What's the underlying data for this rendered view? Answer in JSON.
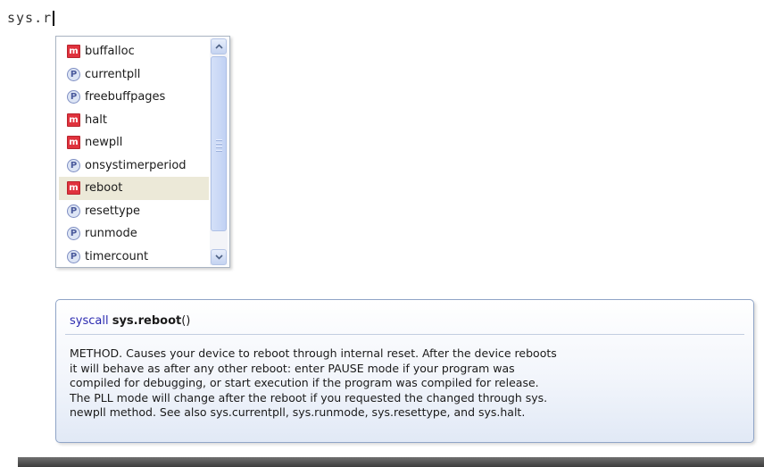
{
  "editor": {
    "text": "sys.r"
  },
  "completion": {
    "items": [
      {
        "label": "buffalloc",
        "kind": "m"
      },
      {
        "label": "currentpll",
        "kind": "P"
      },
      {
        "label": "freebuffpages",
        "kind": "P"
      },
      {
        "label": "halt",
        "kind": "m"
      },
      {
        "label": "newpll",
        "kind": "m"
      },
      {
        "label": "onsystimerperiod",
        "kind": "P"
      },
      {
        "label": "reboot",
        "kind": "m"
      },
      {
        "label": "resettype",
        "kind": "P"
      },
      {
        "label": "runmode",
        "kind": "P"
      },
      {
        "label": "timercount",
        "kind": "P"
      }
    ],
    "selected": "reboot"
  },
  "tooltip": {
    "keyword": "syscall",
    "name": "sys.reboot",
    "params": "()",
    "description": "METHOD. Causes your device to reboot through internal reset. After the device reboots\nit will behave as after any other reboot: enter PAUSE mode if your program was\ncompiled for debugging, or start execution if the program was compiled for release.\nThe PLL mode will change after the reboot if you requested the changed through sys.\nnewpll method. See also sys.currentpll, sys.runmode, sys.resettype, and sys.halt."
  },
  "colors": {
    "method_icon": "#e0323d",
    "property_icon": "#7f8fc3",
    "selection": "#ece9d8",
    "keyword": "#2a2ab0"
  },
  "icons": {
    "method": "method-icon",
    "property": "property-icon",
    "scroll_up": "scroll-up-icon",
    "scroll_down": "scroll-down-icon"
  }
}
